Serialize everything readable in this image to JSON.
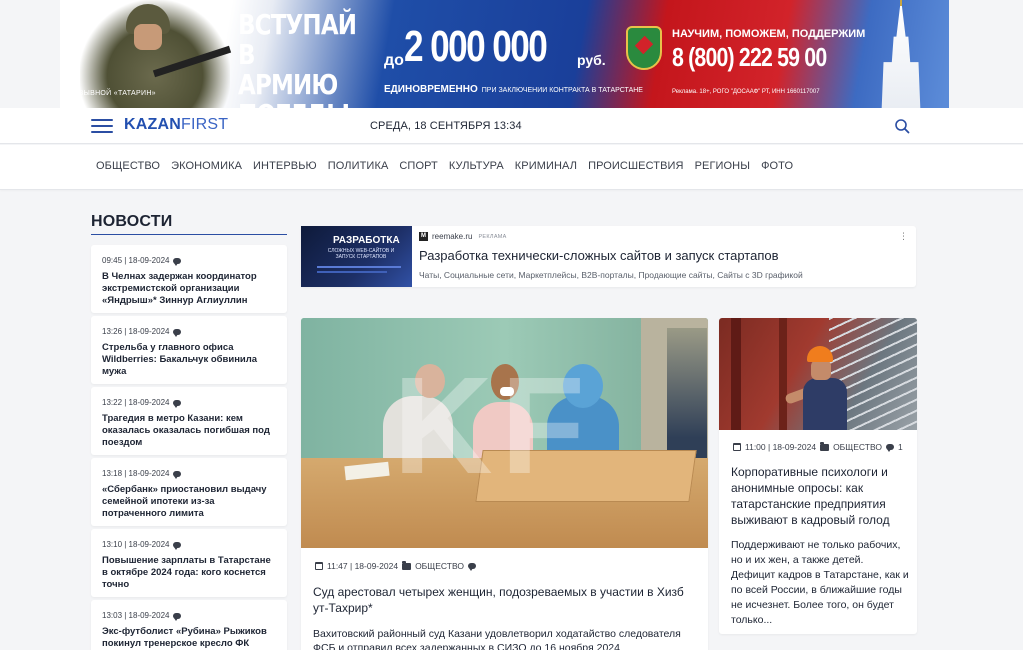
{
  "banner": {
    "caption": "ПОЗЫВНОЙ «ТАТАРИН»",
    "headline": "ВСТУПАЙ В АРМИЮ ПОБЕДЫ",
    "amount_prefix": "до",
    "amount": "2 000 000",
    "amount_suffix": "руб.",
    "once": "ЕДИНОВРЕМЕННО",
    "once_note": "ПРИ ЗАКЛЮЧЕНИИ КОНТРАКТА В ТАТАРСТАНЕ",
    "slogan": "НАУЧИМ, ПОМОЖЕМ, ПОДДЕРЖИМ",
    "phone": "8 (800) 222 59 00",
    "legal": "Реклама. 18+, РОГО \"ДОСААФ\" РТ, ИНН 1660117007"
  },
  "header": {
    "logo_bold": "KAZAN",
    "logo_light": "FIRST",
    "date": "СРЕДА, 18 СЕНТЯБРЯ 13:34"
  },
  "nav": {
    "items": [
      "ОБЩЕСТВО",
      "ЭКОНОМИКА",
      "ИНТЕРВЬЮ",
      "ПОЛИТИКА",
      "СПОРТ",
      "КУЛЬТУРА",
      "КРИМИНАЛ",
      "ПРОИСШЕСТВИЯ",
      "РЕГИОНЫ",
      "ФОТО"
    ]
  },
  "news": {
    "title": "НОВОСТИ",
    "items": [
      {
        "time": "09:45 | 18-09-2024",
        "text": "В Челнах задержан координатор экстремистской организации «Яндрыш»* Зиннур Аглиуллин"
      },
      {
        "time": "13:26 | 18-09-2024",
        "text": "Стрельба у главного офиса Wildberries: Бакальчук обвинила мужа"
      },
      {
        "time": "13:22 | 18-09-2024",
        "text": "Трагедия в метро Казани: кем оказалась оказалась погибшая под поездом"
      },
      {
        "time": "13:18 | 18-09-2024",
        "text": "«Сбербанк» приостановил выдачу семейной ипотеки из-за потраченного лимита"
      },
      {
        "time": "13:10 | 18-09-2024",
        "text": "Повышение зарплаты в Татарстане в октябре 2024 года: кого коснется точно"
      },
      {
        "time": "13:03 | 18-09-2024",
        "text": "Экс-футболист «Рубина» Рыжиков покинул тренерское кресло ФК «Сокол»"
      }
    ]
  },
  "ad": {
    "image_title": "РАЗРАБОТКА",
    "image_sub": "СЛОЖНЫХ WEB-САЙТОВ И ЗАПУСК СТАРТАПОВ",
    "favicon": "М",
    "source": "reemake.ru",
    "tag": "РЕКЛАМА",
    "title": "Разработка технически-сложных сайтов и запуск стартапов",
    "description": "Чаты, Социальные сети, Маркетплейсы, B2B-порталы, Продающие сайты, Сайты с 3D графикой",
    "more": "⋮"
  },
  "main_article": {
    "watermark": "KF",
    "time": "11:47 | 18-09-2024",
    "category": "ОБЩЕСТВО",
    "title": "Суд арестовал четырех женщин, подозреваемых в участии в Хизб ут-Тахрир*",
    "lead": "Вахитовский районный суд Казани удовлетворил ходатайство следователя ФСБ и отправил всех задержанных в СИЗО до 16 ноября 2024"
  },
  "side_article": {
    "time": "11:00 | 18-09-2024",
    "category": "ОБЩЕСТВО",
    "comments": "1",
    "title": "Корпоративные психологи и анонимные опросы: как татарстанские предприятия выживают в кадровый голод",
    "lead": "Поддерживают не только рабочих, но и их жен, а также детей. Дефицит кадров в Татарстане, как и по всей России, в ближайшие годы не исчезнет. Более того, он будет только..."
  },
  "colors": {
    "brand": "#2350b0",
    "text": "#1d2433",
    "background": "#f4f5f7"
  }
}
